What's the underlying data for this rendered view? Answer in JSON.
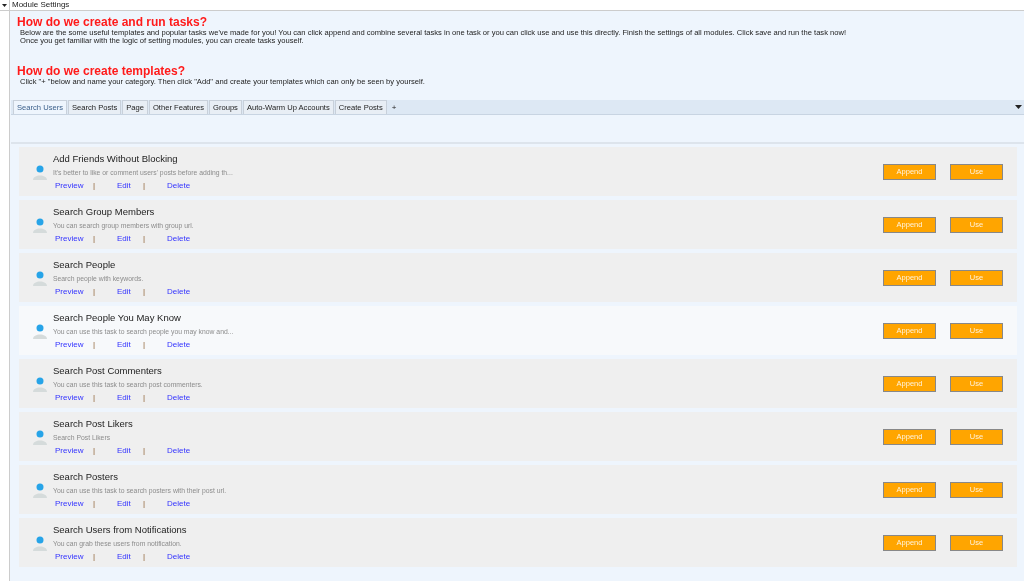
{
  "header": {
    "title": "Module Settings"
  },
  "intro": [
    {
      "heading": "How do we create and run tasks?",
      "lines": [
        "Below are the some useful templates and popular tasks we've made for you!  You can click append and combine several tasks in one task or you can click use and use this directly. Finish the settings of all modules. Click save and run the task now!",
        "Once you get familiar with the logic of setting modules, you can create tasks youself."
      ]
    },
    {
      "heading": "How do we create templates?",
      "lines": [
        "Click \"+ \"below and name your category. Then click \"Add\" and create your templates which can only be seen by yourself."
      ]
    }
  ],
  "tabs": [
    {
      "label": "Search Users",
      "selected": true
    },
    {
      "label": "Search Posts",
      "selected": false
    },
    {
      "label": "Page",
      "selected": false
    },
    {
      "label": "Other Features",
      "selected": false
    },
    {
      "label": "Groups",
      "selected": false
    },
    {
      "label": "Auto-Warm Up  Accounts",
      "selected": false
    },
    {
      "label": "Create Posts",
      "selected": false
    }
  ],
  "add_tab": "+",
  "templates": [
    {
      "title": "Add Friends Without Blocking",
      "description": "It's better to like or comment users' posts before adding th...",
      "selected": false,
      "links": [
        "Preview",
        "|",
        "Edit",
        "|",
        "Delete"
      ],
      "buttons": [
        "Append",
        "Use"
      ]
    },
    {
      "title": "Search Group Members",
      "description": "You can search group members with group url.",
      "selected": false,
      "links": [
        "Preview",
        "|",
        "Edit",
        "|",
        "Delete"
      ],
      "buttons": [
        "Append",
        "Use"
      ]
    },
    {
      "title": "Search People",
      "description": "Search people with keywords.",
      "selected": false,
      "links": [
        "Preview",
        "|",
        "Edit",
        "|",
        "Delete"
      ],
      "buttons": [
        "Append",
        "Use"
      ]
    },
    {
      "title": "Search People You May Know",
      "description": "You can use this task to search people you may know and...",
      "selected": true,
      "links": [
        "Preview",
        "|",
        "Edit",
        "|",
        "Delete"
      ],
      "buttons": [
        "Append",
        "Use"
      ]
    },
    {
      "title": "Search Post Commenters",
      "description": "You can use this task to search post commenters.",
      "selected": false,
      "links": [
        "Preview",
        "|",
        "Edit",
        "|",
        "Delete"
      ],
      "buttons": [
        "Append",
        "Use"
      ]
    },
    {
      "title": "Search Post Likers",
      "description": "Search Post Likers",
      "selected": false,
      "links": [
        "Preview",
        "|",
        "Edit",
        "|",
        "Delete"
      ],
      "buttons": [
        "Append",
        "Use"
      ]
    },
    {
      "title": "Search Posters",
      "description": "You can use this task to search posters with their post url.",
      "selected": false,
      "links": [
        "Preview",
        "|",
        "Edit",
        "|",
        "Delete"
      ],
      "buttons": [
        "Append",
        "Use"
      ]
    },
    {
      "title": "Search Users from Notifications",
      "description": "You can grab these users from notification.",
      "selected": false,
      "links": [
        "Preview",
        "|",
        "Edit",
        "|",
        "Delete"
      ],
      "buttons": [
        "Append",
        "Use"
      ]
    }
  ]
}
